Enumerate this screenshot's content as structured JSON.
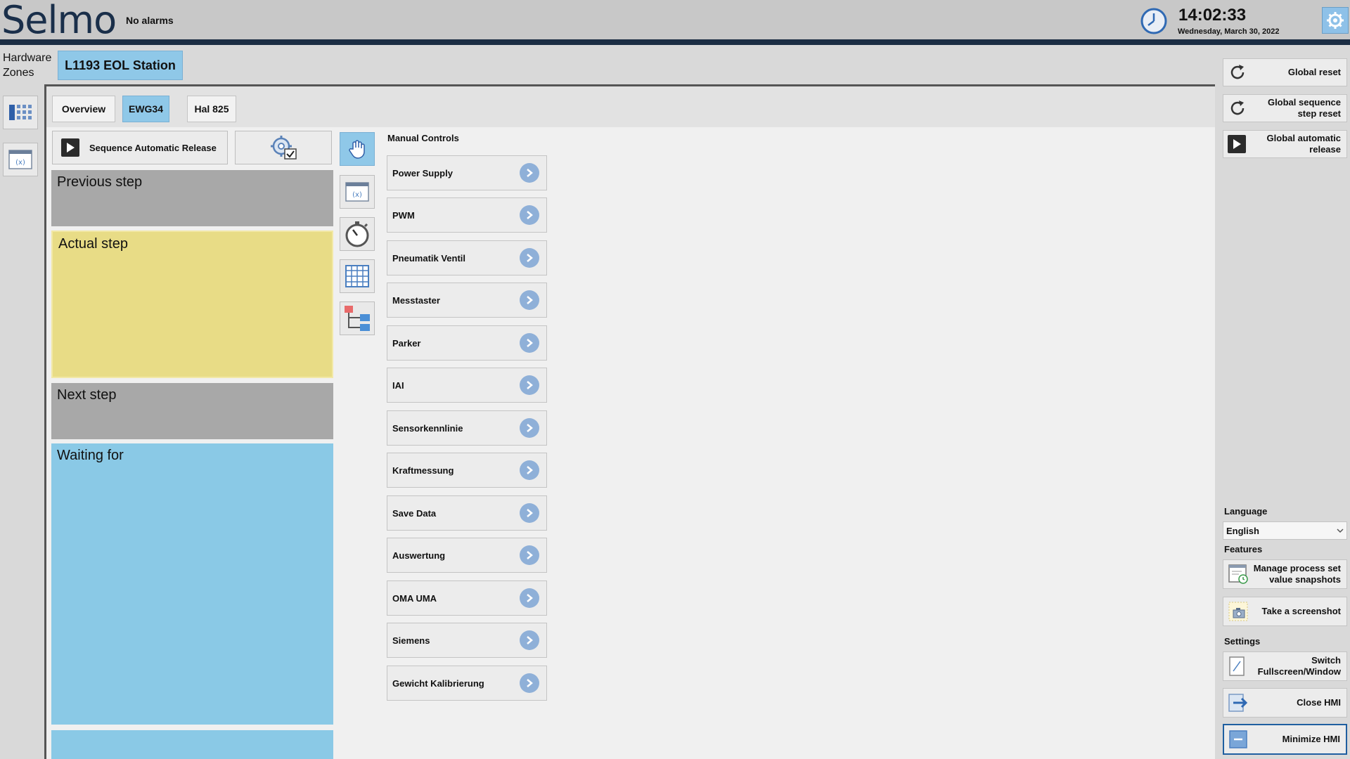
{
  "header": {
    "logo": "Selmo",
    "alarm_status": "No alarms",
    "time": "14:02:33",
    "date": "Wednesday, March 30, 2022"
  },
  "zones": {
    "label": "Hardware Zones",
    "active_zone": "L1193 EOL Station"
  },
  "subtabs": [
    {
      "label": "Overview",
      "active": false
    },
    {
      "label": "EWG34",
      "active": true
    },
    {
      "label": "Hal 825",
      "active": false
    }
  ],
  "sequence": {
    "release_label": "Sequence Automatic Release",
    "previous_step": "Previous step",
    "actual_step": "Actual step",
    "next_step": "Next step",
    "waiting_for": "Waiting for"
  },
  "manual_controls": {
    "title": "Manual Controls",
    "items": [
      "Power Supply",
      "PWM",
      "Pneumatik Ventil",
      "Messtaster",
      "Parker",
      "IAI",
      "Sensorkennlinie",
      "Kraftmessung",
      "Save Data",
      "Auswertung",
      "OMA UMA",
      "Siemens",
      "Gewicht Kalibrierung"
    ]
  },
  "right_panel": {
    "global_reset": "Global reset",
    "global_sequence_step_reset": "Global sequence step reset",
    "global_automatic_release": "Global automatic release",
    "language_label": "Language",
    "language_value": "English",
    "features_label": "Features",
    "manage_snapshots": "Manage process set value snapshots",
    "take_screenshot": "Take a screenshot",
    "settings_label": "Settings",
    "switch_fullscreen": "Switch Fullscreen/Window",
    "close_hmi": "Close HMI",
    "minimize_hmi": "Minimize HMI"
  },
  "colors": {
    "accent": "#8fc8e8",
    "header_bar": "#1c2e44",
    "actual_step": "#e8dc86",
    "waiting_for": "#8ac9e6",
    "step_gray": "#a8a8a8"
  }
}
